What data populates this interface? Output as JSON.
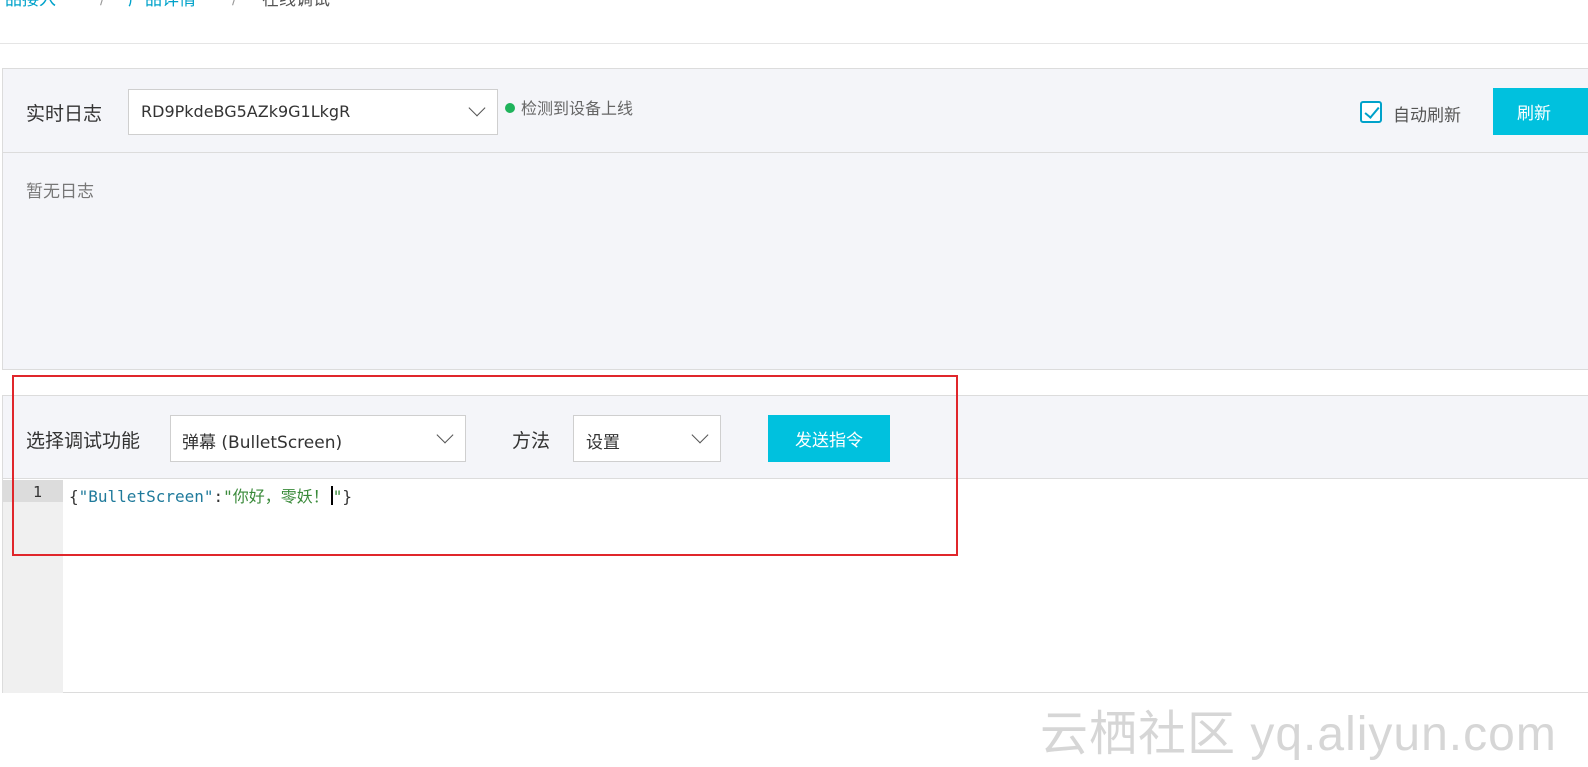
{
  "breadcrumb": {
    "items": [
      "产品接入",
      "产品详情"
    ],
    "separator": "/",
    "current": "在线调试"
  },
  "log_panel": {
    "title": "实时日志",
    "device_select": {
      "value": "RD9PkdeBG5AZk9G1LkgR"
    },
    "status_text": "检测到设备上线",
    "auto_refresh": {
      "label": "自动刷新",
      "checked": true
    },
    "refresh_button": "刷新",
    "empty_message": "暂无日志"
  },
  "debug_panel": {
    "function_label": "选择调试功能",
    "function_select": {
      "value": "弹幕 (BulletScreen)"
    },
    "method_label": "方法",
    "method_select": {
      "value": "设置"
    },
    "send_button": "发送指令",
    "editor": {
      "line_number": "1",
      "code": {
        "open": "{",
        "key": "\"BulletScreen\"",
        "colon": ":",
        "value_text": "\"你好，零妖！",
        "value_end": "\"",
        "close": "}"
      }
    }
  },
  "watermark": "云栖社区 yq.aliyun.com",
  "colors": {
    "accent": "#00c1de",
    "link": "#00a2ca",
    "status_online": "#1fb35b",
    "highlight": "#e0262b",
    "panel_bg": "#f4f5f9"
  }
}
